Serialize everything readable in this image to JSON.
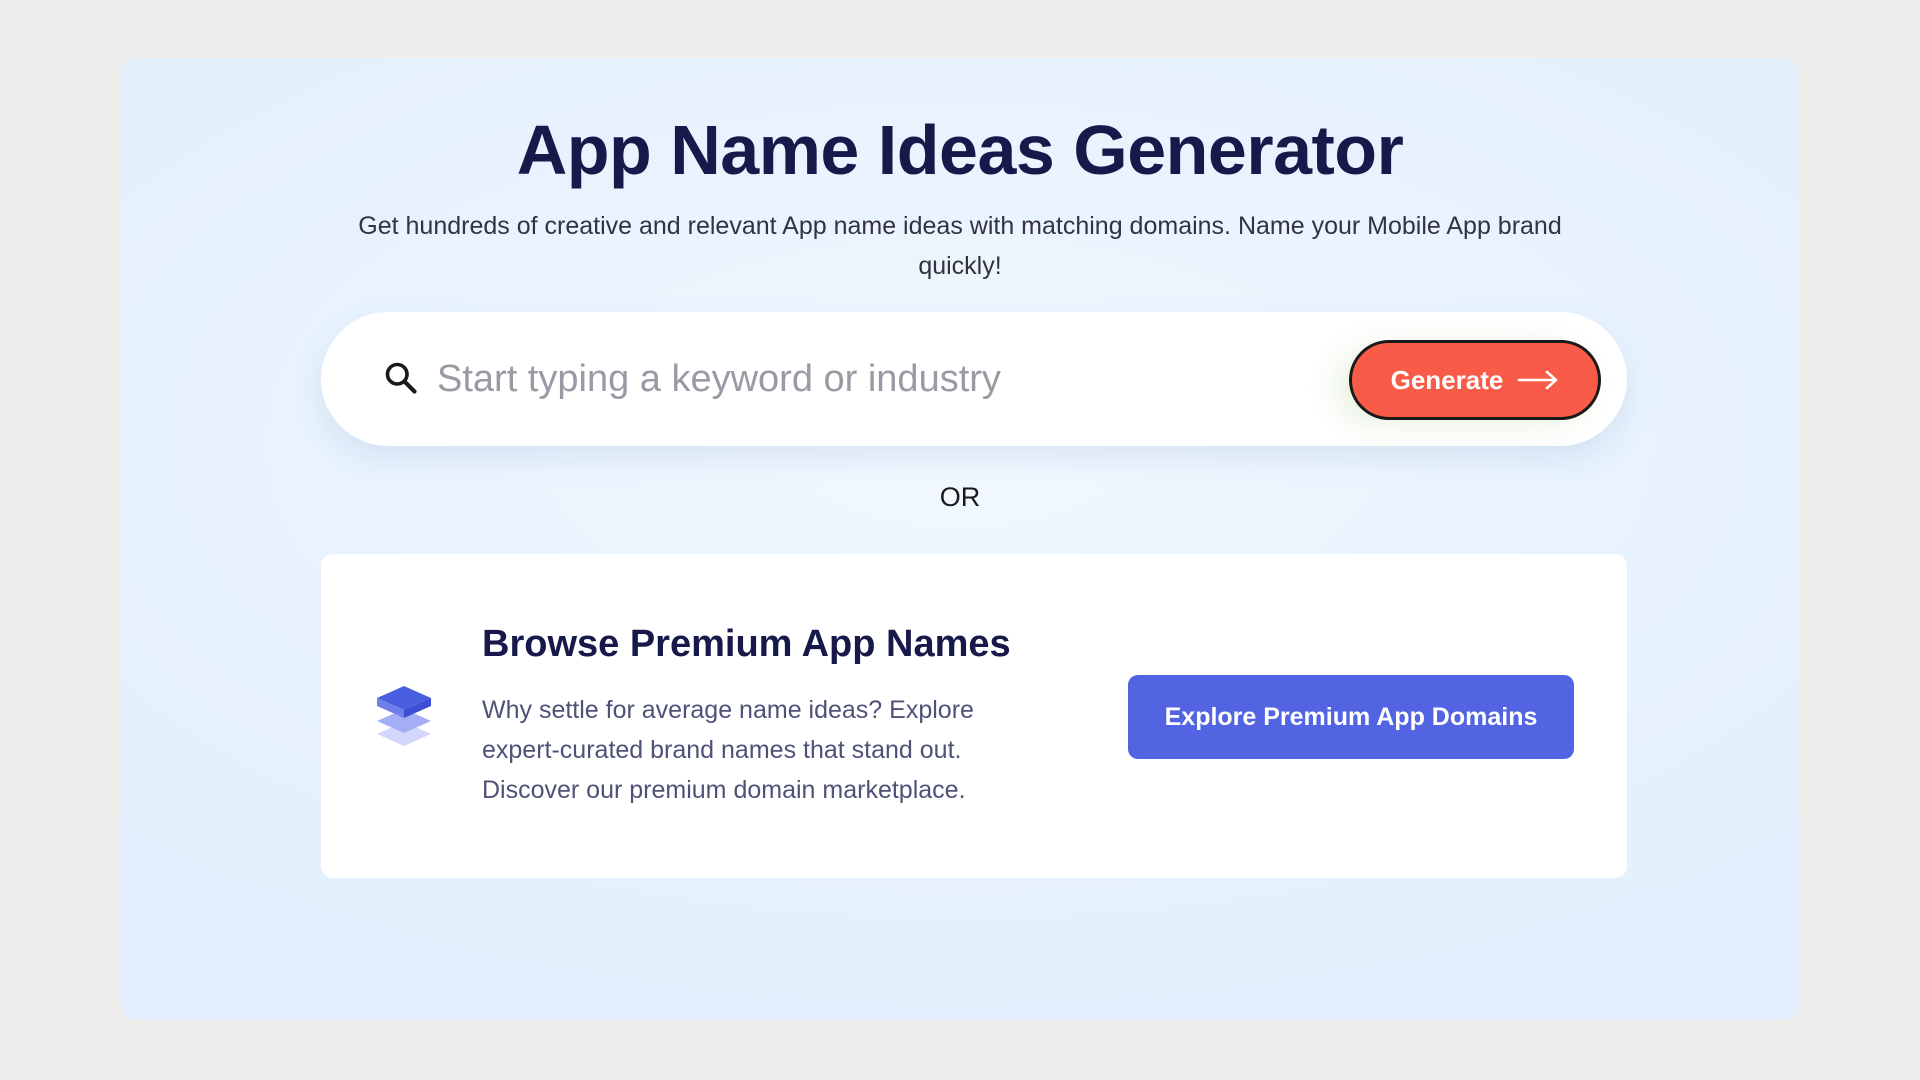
{
  "hero": {
    "title": "App Name Ideas Generator",
    "subtitle": "Get hundreds of creative and relevant App name ideas with matching domains. Name your Mobile App brand quickly!"
  },
  "search": {
    "icon": "search-icon",
    "placeholder": "Start typing a keyword or industry",
    "value": "",
    "generate_label": "Generate",
    "generate_icon": "arrow-right-icon"
  },
  "divider": {
    "text": "OR"
  },
  "premium": {
    "icon": "layers-icon",
    "title": "Browse Premium App Names",
    "description": "Why settle for average name ideas? Explore expert-curated brand names that stand out. Discover our premium domain marketplace.",
    "button_label": "Explore Premium App Domains"
  },
  "colors": {
    "title_navy": "#17194a",
    "generate_coral": "#f85b47",
    "explore_blue": "#5264e2",
    "hero_bg": "#e8f3fe"
  }
}
